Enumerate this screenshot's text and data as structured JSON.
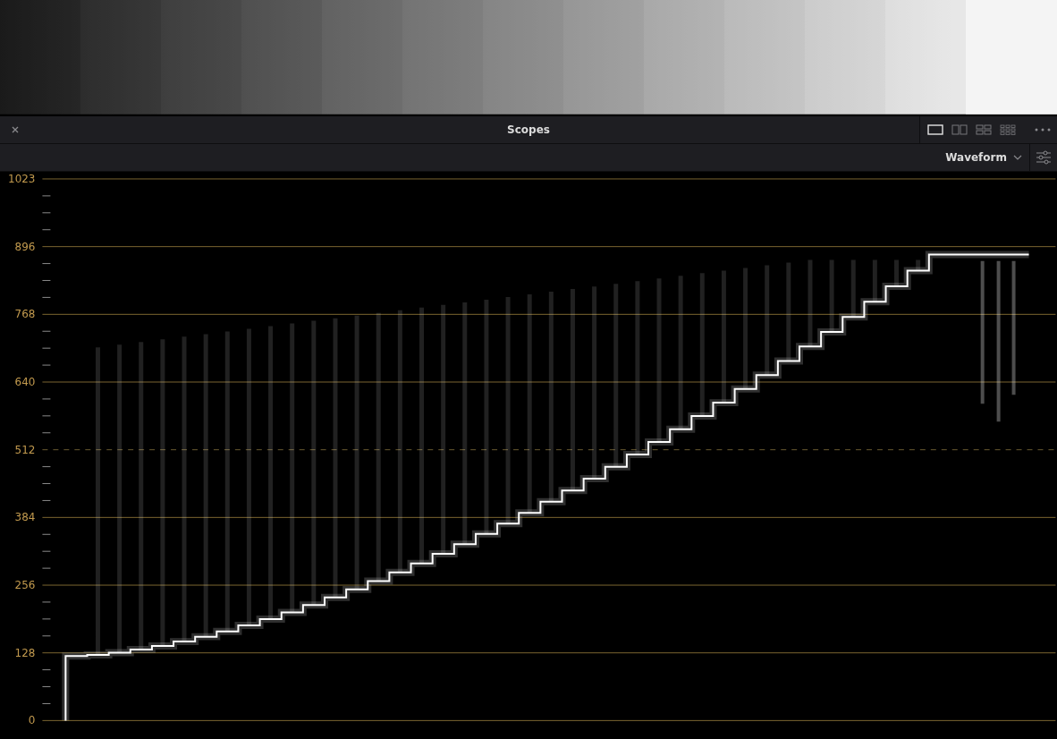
{
  "panel": {
    "title": "Scopes",
    "layouts": [
      {
        "kind": "single",
        "selected": true
      },
      {
        "kind": "dual",
        "selected": false
      },
      {
        "kind": "quad",
        "selected": false
      },
      {
        "kind": "grid",
        "selected": false
      }
    ],
    "scope_menu": {
      "value": "Waveform"
    }
  },
  "waveform": {
    "scale_labels": [
      "1023",
      "896",
      "768",
      "640",
      "512",
      "384",
      "256",
      "128",
      "0"
    ]
  }
}
